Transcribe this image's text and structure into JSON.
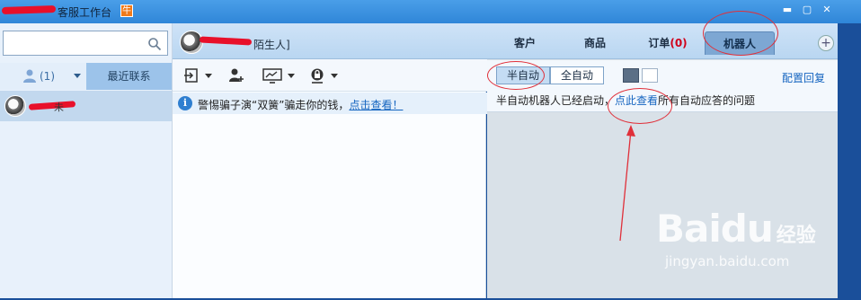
{
  "window": {
    "title": "客服工作台",
    "badge": "牛",
    "minimize": "▬",
    "maximize": "▢",
    "close": "✕"
  },
  "left": {
    "search": {
      "placeholder": "",
      "value": ""
    },
    "contacts_count": "(1)",
    "recent_tab": "最近联系",
    "contact_suffix": "未"
  },
  "chat": {
    "name": "陌生人]",
    "notice_text": "警惕骗子演“双簧”骗走你的钱，",
    "notice_link": "点击查看！"
  },
  "right": {
    "tabs": {
      "customer": "客户",
      "product": "商品",
      "order": "订单",
      "order_count": "(0)",
      "robot": "机器人"
    },
    "add_tab": "+",
    "mode_semi": "半自动",
    "mode_full": "全自动",
    "config": "配置回复",
    "status_prefix": "半自动机器人已经启动，",
    "status_link": "点此查看",
    "status_suffix": "所有自动应答的问题"
  },
  "watermark": {
    "logo": "Baidu",
    "cn": "经验",
    "url": "jingyan.baidu.com"
  },
  "colors": {
    "title_bar": "#2f86d8",
    "link": "#1565c0",
    "annotation": "#e0303a",
    "order_count": "#d0021b"
  }
}
